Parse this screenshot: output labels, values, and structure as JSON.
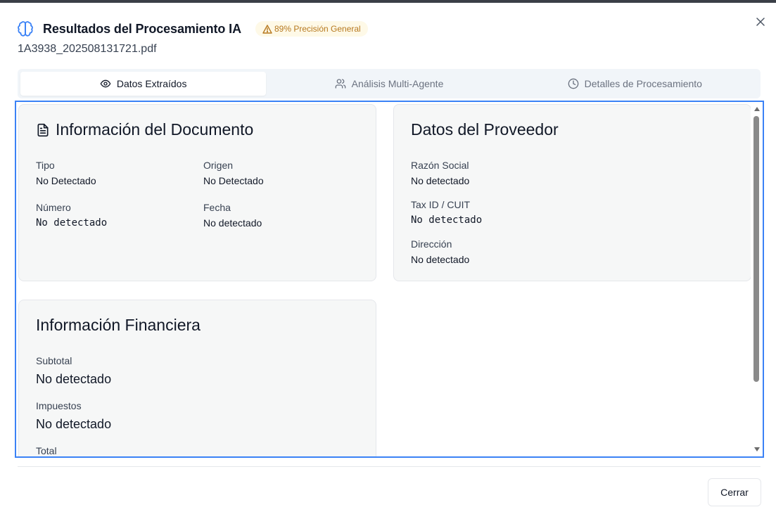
{
  "header": {
    "title": "Resultados del Procesamiento IA",
    "badge": "89% Precisión General",
    "filename": "1A3938_202508131721.pdf"
  },
  "tabs": [
    {
      "label": "Datos Extraídos",
      "icon": "eye-icon",
      "active": true
    },
    {
      "label": "Análisis Multi-Agente",
      "icon": "users-icon",
      "active": false
    },
    {
      "label": "Detalles de Procesamiento",
      "icon": "clock-icon",
      "active": false
    }
  ],
  "document_card": {
    "title": "Información del Documento",
    "fields": {
      "tipo": {
        "label": "Tipo",
        "value": "No Detectado"
      },
      "origen": {
        "label": "Origen",
        "value": "No Detectado"
      },
      "numero": {
        "label": "Número",
        "value": "No detectado"
      },
      "fecha": {
        "label": "Fecha",
        "value": "No detectado"
      }
    }
  },
  "provider_card": {
    "title": "Datos del Proveedor",
    "fields": {
      "razon_social": {
        "label": "Razón Social",
        "value": "No detectado"
      },
      "tax_id": {
        "label": "Tax ID / CUIT",
        "value": "No detectado"
      },
      "direccion": {
        "label": "Dirección",
        "value": "No detectado"
      }
    }
  },
  "financial_card": {
    "title": "Información Financiera",
    "fields": {
      "subtotal": {
        "label": "Subtotal",
        "value": "No detectado"
      },
      "impuestos": {
        "label": "Impuestos",
        "value": "No detectado"
      },
      "total": {
        "label": "Total",
        "value": ""
      }
    }
  },
  "footer": {
    "close_label": "Cerrar"
  },
  "colors": {
    "accent": "#3b82f6",
    "badge_text": "#b7791f",
    "badge_bg": "#fef9e7",
    "card_bg": "#f6f7f7"
  }
}
